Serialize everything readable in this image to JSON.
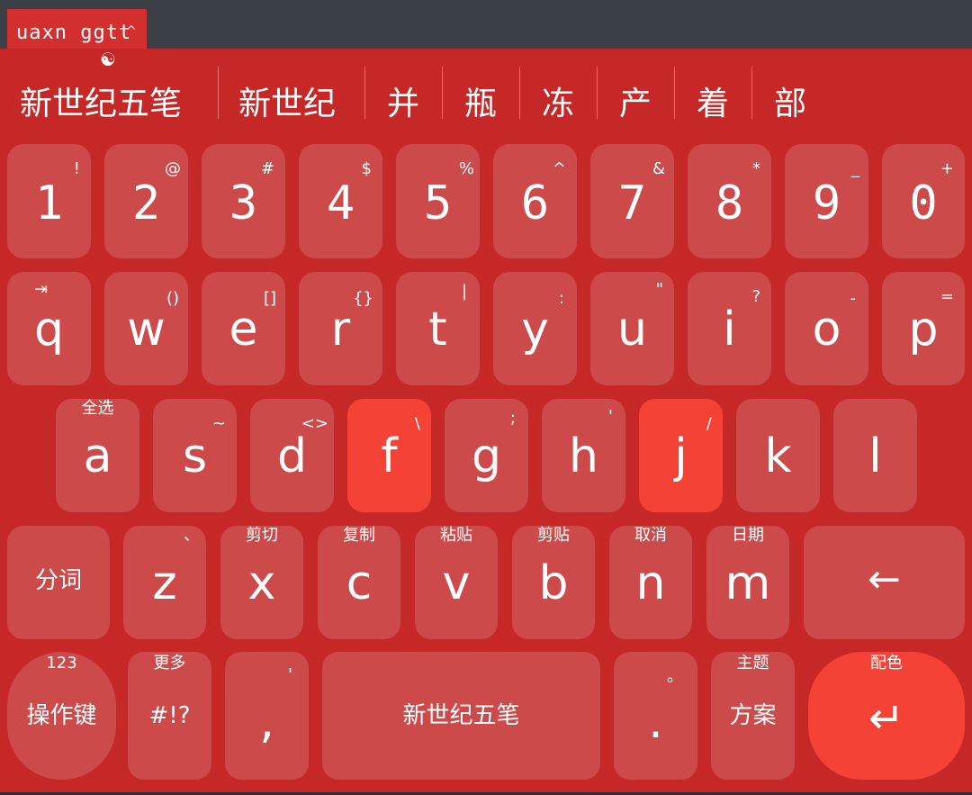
{
  "composition": {
    "text": "uaxn ggtt",
    "caret": "^"
  },
  "logo_icon": "yin-yang-icon",
  "logo_glyph": "☯",
  "candidates": [
    "新世纪五笔",
    "新世纪",
    "并",
    "瓶",
    "冻",
    "产",
    "着",
    "部"
  ],
  "rows": {
    "numbers": [
      {
        "main": "1",
        "sub": "!"
      },
      {
        "main": "2",
        "sub": "@"
      },
      {
        "main": "3",
        "sub": "#"
      },
      {
        "main": "4",
        "sub": "$"
      },
      {
        "main": "5",
        "sub": "%"
      },
      {
        "main": "6",
        "sub": "^"
      },
      {
        "main": "7",
        "sub": "&"
      },
      {
        "main": "8",
        "sub": "*"
      },
      {
        "main": "9",
        "sub": "_"
      },
      {
        "main": "0",
        "sub": "+"
      }
    ],
    "qwerty": [
      {
        "main": "q",
        "sub": "⇥"
      },
      {
        "main": "w",
        "sub": "()"
      },
      {
        "main": "e",
        "sub": "[]"
      },
      {
        "main": "r",
        "sub": "{}"
      },
      {
        "main": "t",
        "sub": "|"
      },
      {
        "main": "y",
        "sub": ":"
      },
      {
        "main": "u",
        "sub": "\""
      },
      {
        "main": "i",
        "sub": "?"
      },
      {
        "main": "o",
        "sub": "-"
      },
      {
        "main": "p",
        "sub": "="
      }
    ],
    "asdf": [
      {
        "main": "a",
        "hint": "全选"
      },
      {
        "main": "s",
        "sub": "~"
      },
      {
        "main": "d",
        "sub": "<>"
      },
      {
        "main": "f",
        "sub": "\\"
      },
      {
        "main": "g",
        "sub": ";"
      },
      {
        "main": "h",
        "sub": "'"
      },
      {
        "main": "j",
        "sub": "/"
      },
      {
        "main": "k",
        "sub": ""
      },
      {
        "main": "l",
        "sub": ""
      }
    ],
    "zxcv": [
      {
        "main": "z",
        "hint": "、"
      },
      {
        "main": "x",
        "hint": "剪切"
      },
      {
        "main": "c",
        "hint": "复制"
      },
      {
        "main": "v",
        "hint": "粘贴"
      },
      {
        "main": "b",
        "hint": "剪贴"
      },
      {
        "main": "n",
        "hint": "取消"
      },
      {
        "main": "m",
        "hint": "日期"
      }
    ]
  },
  "special": {
    "segment_label": "分词",
    "backspace_glyph": "←",
    "ops_hint": "123",
    "ops_label": "操作键",
    "symbols_hint": "更多",
    "symbols_label": "#!?",
    "comma_hint": "'",
    "comma_main": ",",
    "space_label": "新世纪五笔",
    "period_hint": "。",
    "period_main": ".",
    "scheme_hint": "主题",
    "scheme_label": "方案",
    "enter_hint": "配色",
    "enter_glyph": "↵"
  },
  "colors": {
    "keyboard_bg": "#c62828",
    "key_bg": "#cd4a4a",
    "accent_key": "#f44336",
    "top_bar": "#3b4047"
  }
}
